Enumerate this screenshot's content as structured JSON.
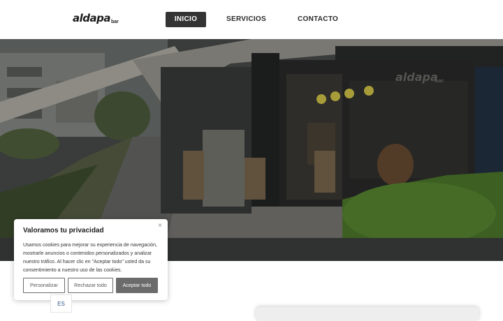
{
  "header": {
    "logo_main": "aldapa",
    "logo_sub": "bar",
    "nav": [
      {
        "label": "INICIO",
        "active": true
      },
      {
        "label": "SERVICIOS",
        "active": false
      },
      {
        "label": "CONTACTO",
        "active": false
      }
    ]
  },
  "hero": {
    "sign_main": "aldapa",
    "sign_sub": "bar"
  },
  "cookie_banner": {
    "title": "Valoramos tu privacidad",
    "close": "×",
    "text": "Usamos cookies para mejorar su experiencia de navegación, mostrarle anuncios o contenidos personalizados y analizar nuestro tráfico. Al hacer clic en \"Aceptar todo\" usted da su consentimiento a nuestro uso de las cookies.",
    "customize_label": "Personalizar",
    "reject_label": "Rechazar todo",
    "accept_label": "Aceptar todo"
  },
  "language": {
    "current": "ES"
  },
  "colors": {
    "nav_active_bg": "#343434",
    "accept_bg": "#6b6b6b",
    "lang_text": "#2c5b8a"
  }
}
